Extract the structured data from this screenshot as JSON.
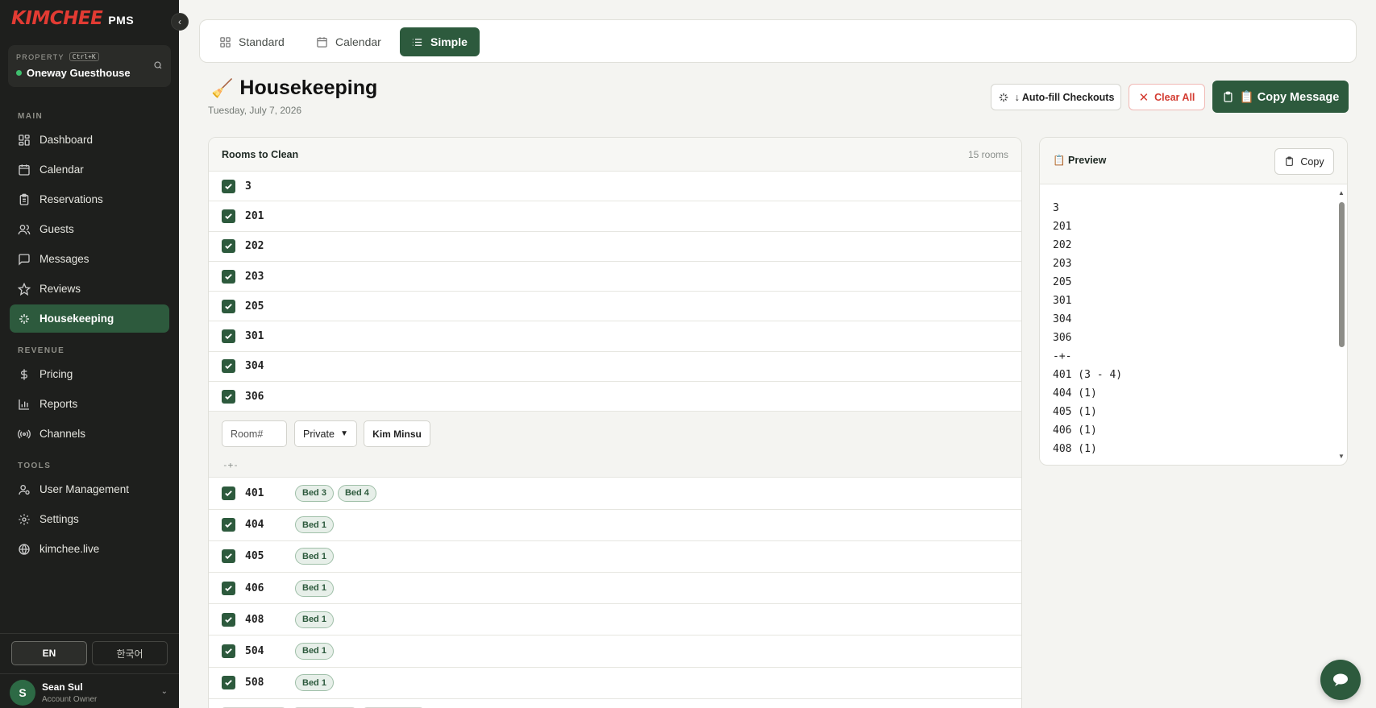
{
  "brand": {
    "logo": "KIMCHEE",
    "suffix": "PMS"
  },
  "property": {
    "label": "PROPERTY",
    "shortcut": "Ctrl+K",
    "name": "Oneway Guesthouse"
  },
  "nav": {
    "main_label": "MAIN",
    "main": [
      {
        "label": "Dashboard",
        "icon": "grid-icon"
      },
      {
        "label": "Calendar",
        "icon": "calendar-icon"
      },
      {
        "label": "Reservations",
        "icon": "clipboard-icon"
      },
      {
        "label": "Guests",
        "icon": "users-icon"
      },
      {
        "label": "Messages",
        "icon": "message-icon"
      },
      {
        "label": "Reviews",
        "icon": "star-icon"
      },
      {
        "label": "Housekeeping",
        "icon": "sparkle-icon",
        "active": true
      }
    ],
    "revenue_label": "REVENUE",
    "revenue": [
      {
        "label": "Pricing",
        "icon": "dollar-icon"
      },
      {
        "label": "Reports",
        "icon": "bar-chart-icon"
      },
      {
        "label": "Channels",
        "icon": "radio-icon"
      }
    ],
    "tools_label": "TOOLS",
    "tools": [
      {
        "label": "User Management",
        "icon": "user-cog-icon"
      },
      {
        "label": "Settings",
        "icon": "gear-icon"
      },
      {
        "label": "kimchee.live",
        "icon": "globe-icon"
      }
    ]
  },
  "language": {
    "en": "EN",
    "ko": "한국어",
    "selected": "EN"
  },
  "user": {
    "initial": "S",
    "name": "Sean Sul",
    "role": "Account Owner"
  },
  "view_tabs": [
    {
      "label": "Standard",
      "icon": "grid-icon"
    },
    {
      "label": "Calendar",
      "icon": "calendar-icon"
    },
    {
      "label": "Simple",
      "icon": "list-icon",
      "active": true
    }
  ],
  "page": {
    "emoji": "🧹",
    "title": "Housekeeping",
    "date": "Tuesday, July 7, 2026"
  },
  "actions": {
    "autofill": "↓ Auto-fill Checkouts",
    "clear": "Clear All",
    "copy": "📋 Copy Message"
  },
  "rooms_card": {
    "title": "Rooms to Clean",
    "count": "15 rooms",
    "private_rooms": [
      "3",
      "201",
      "202",
      "203",
      "205",
      "301",
      "304",
      "306"
    ],
    "add": {
      "room_placeholder": "Room#",
      "type_value": "Private",
      "staff_button": "Kim Minsu"
    },
    "separator": "-+-",
    "bed_rooms": [
      {
        "room": "401",
        "beds": [
          "Bed 3",
          "Bed 4"
        ]
      },
      {
        "room": "404",
        "beds": [
          "Bed 1"
        ]
      },
      {
        "room": "405",
        "beds": [
          "Bed 1"
        ]
      },
      {
        "room": "406",
        "beds": [
          "Bed 1"
        ]
      },
      {
        "room": "408",
        "beds": [
          "Bed 1"
        ]
      },
      {
        "room": "504",
        "beds": [
          "Bed 1"
        ]
      },
      {
        "room": "508",
        "beds": [
          "Bed 1"
        ]
      }
    ]
  },
  "preview": {
    "title": "📋 Preview",
    "copy_label": "Copy",
    "lines": [
      "3",
      "201",
      "202",
      "203",
      "205",
      "301",
      "304",
      "306",
      "-+-",
      "401 (3 - 4)",
      "404 (1)",
      "405 (1)",
      "406 (1)",
      "408 (1)"
    ]
  },
  "colors": {
    "accent": "#2d5a3d",
    "brand_red": "#e23b33",
    "danger": "#d33b31",
    "sidebar_bg": "#1e1f1d"
  }
}
